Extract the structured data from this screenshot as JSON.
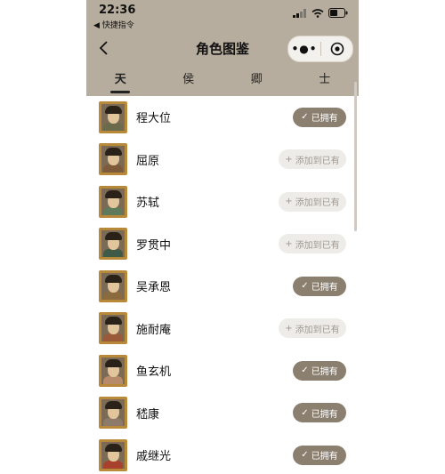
{
  "status_bar": {
    "time": "22:36",
    "back_app": "◀ 快捷指令"
  },
  "nav": {
    "title": "角色图鉴"
  },
  "tabs": [
    {
      "label": "天",
      "active": true
    },
    {
      "label": "侯",
      "active": false
    },
    {
      "label": "卿",
      "active": false
    },
    {
      "label": "士",
      "active": false
    }
  ],
  "list": [
    {
      "name": "程大位",
      "button": "已拥有",
      "owned": true
    },
    {
      "name": "屈原",
      "button": "添加到已有",
      "owned": false
    },
    {
      "name": "苏轼",
      "button": "添加到已有",
      "owned": false
    },
    {
      "name": "罗贯中",
      "button": "添加到已有",
      "owned": false
    },
    {
      "name": "吴承恩",
      "button": "已拥有",
      "owned": true
    },
    {
      "name": "施耐庵",
      "button": "添加到已有",
      "owned": false
    },
    {
      "name": "鱼玄机",
      "button": "已拥有",
      "owned": true
    },
    {
      "name": "嵇康",
      "button": "已拥有",
      "owned": true
    },
    {
      "name": "戚继光",
      "button": "已拥有",
      "owned": true
    }
  ],
  "colors": {
    "header_bg": "#b7ad9e",
    "owned_button": "#8b7f70",
    "add_button": "#eeece9",
    "frame": "#b9893a"
  }
}
